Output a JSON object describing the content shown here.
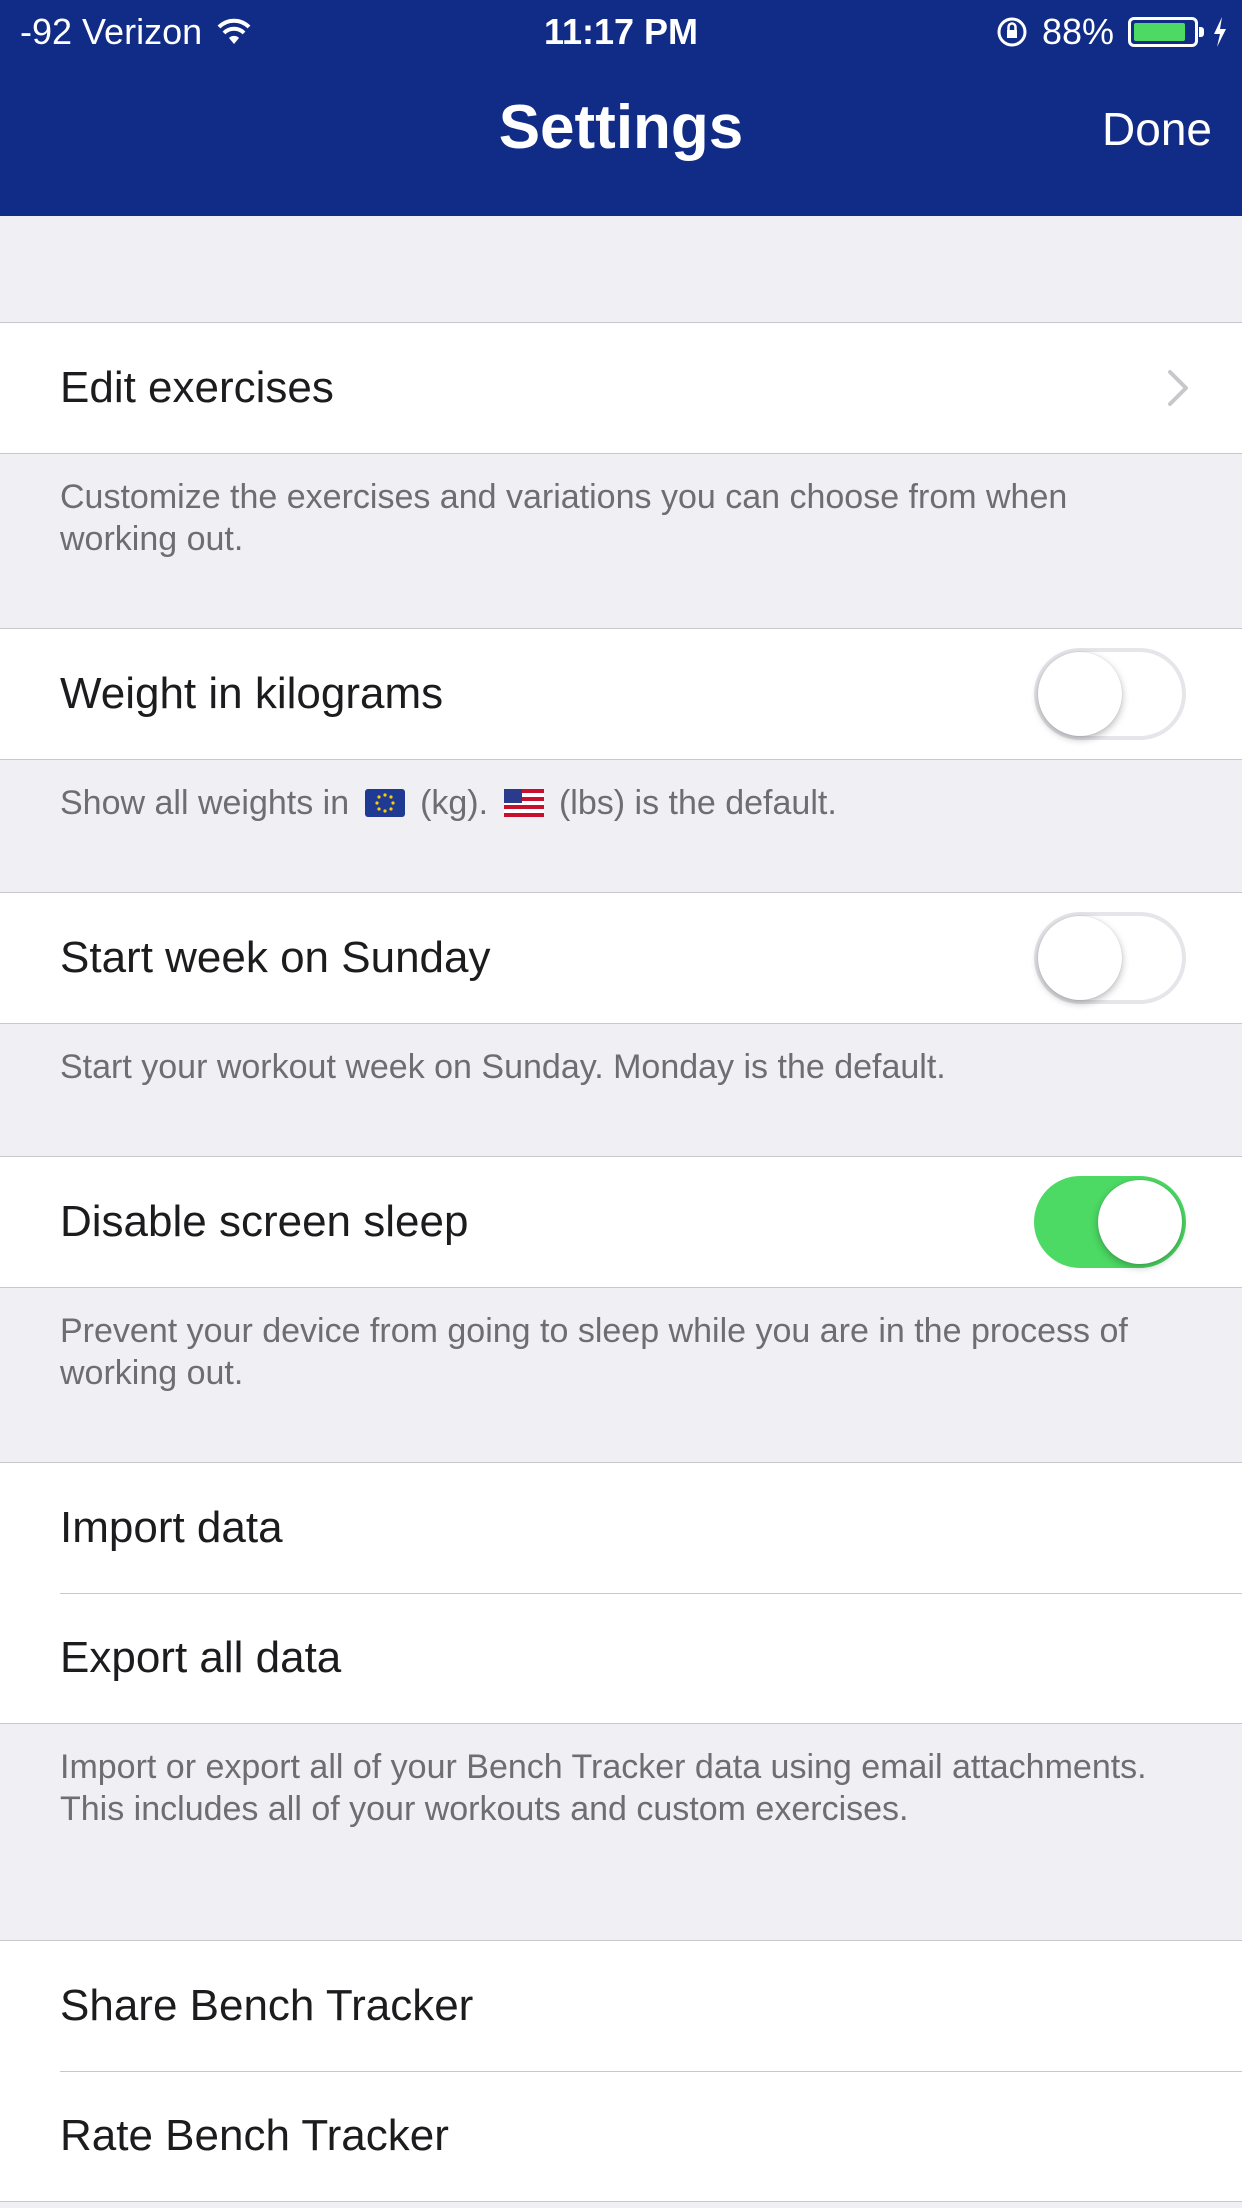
{
  "status_bar": {
    "carrier": "-92 Verizon",
    "time": "11:17 PM",
    "battery": "88%",
    "battery_level": 0.88
  },
  "nav": {
    "title": "Settings",
    "done_label": "Done"
  },
  "sections": {
    "edit_exercises": {
      "label": "Edit exercises",
      "footer": "Customize the exercises and variations you can choose from when working out."
    },
    "weight": {
      "label": "Weight in kilograms",
      "on": false,
      "footer_prefix": "Show all weights in",
      "footer_mid": "(kg).",
      "footer_suffix": "(lbs) is the default."
    },
    "start_week": {
      "label": "Start week on Sunday",
      "on": false,
      "footer": "Start your workout week on Sunday. Monday is the default."
    },
    "screen_sleep": {
      "label": "Disable screen sleep",
      "on": true,
      "footer": "Prevent your device from going to sleep while you are in the process of working out."
    },
    "data": {
      "import_label": "Import data",
      "export_label": "Export all data",
      "footer": "Import or export all of your Bench Tracker data using email attachments. This includes all of your workouts and custom exercises."
    },
    "share": {
      "share_label": "Share Bench Tracker",
      "rate_label": "Rate Bench Tracker"
    }
  },
  "colors": {
    "nav_bg": "#112c87",
    "toggle_on": "#4cd964",
    "background": "#efeff4"
  }
}
